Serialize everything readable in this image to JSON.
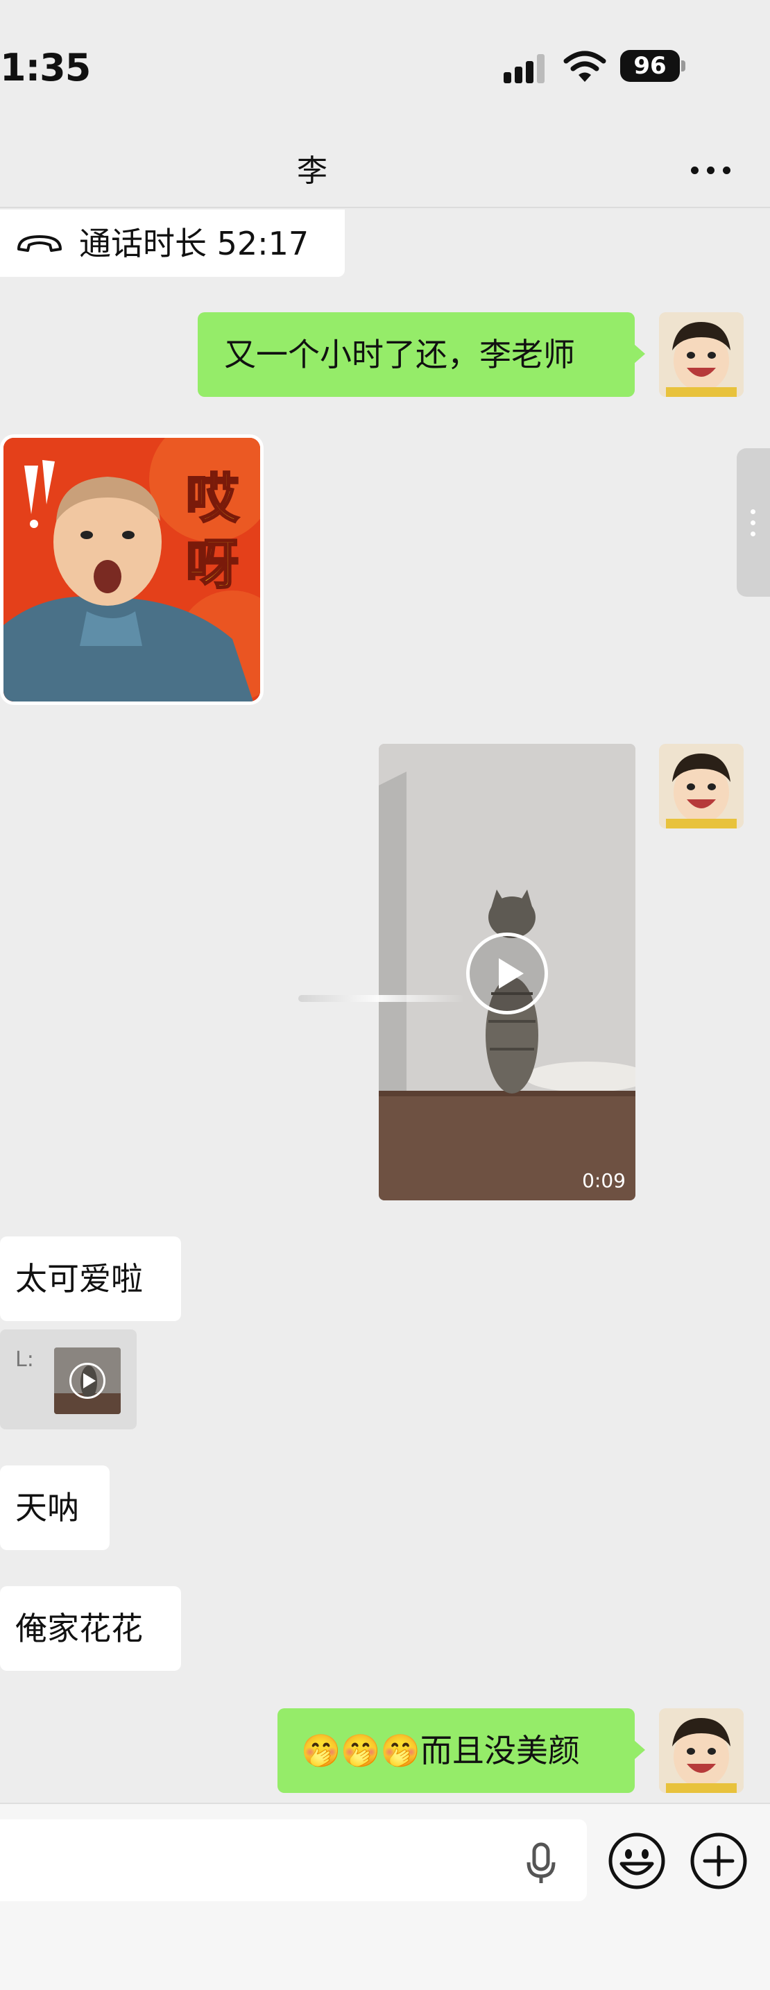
{
  "status_bar": {
    "time": "1:35",
    "battery": "96"
  },
  "header": {
    "title": "李"
  },
  "messages": {
    "call": {
      "text": "通话时长 52:17"
    },
    "out_1": {
      "text": "又一个小时了还，李老师"
    },
    "sticker": {
      "text_line1": "哎",
      "text_line2": "呀"
    },
    "video": {
      "duration": "0:09"
    },
    "in_1": {
      "text": "太可爱啦"
    },
    "quote": {
      "label": "L:"
    },
    "in_2": {
      "text": "天呐"
    },
    "in_3": {
      "text": "俺家花花"
    },
    "out_2": {
      "text": "🤭🤭🤭而且没美颜"
    }
  },
  "input_bar": {
    "value": ""
  },
  "colors": {
    "background": "#ededed",
    "outgoing_bubble": "#95ec69",
    "incoming_bubble": "#ffffff"
  },
  "icons": [
    "signal-icon",
    "wifi-icon",
    "more-icon",
    "phone-hangup-icon",
    "play-icon",
    "microphone-icon",
    "emoji-icon",
    "add-icon"
  ]
}
